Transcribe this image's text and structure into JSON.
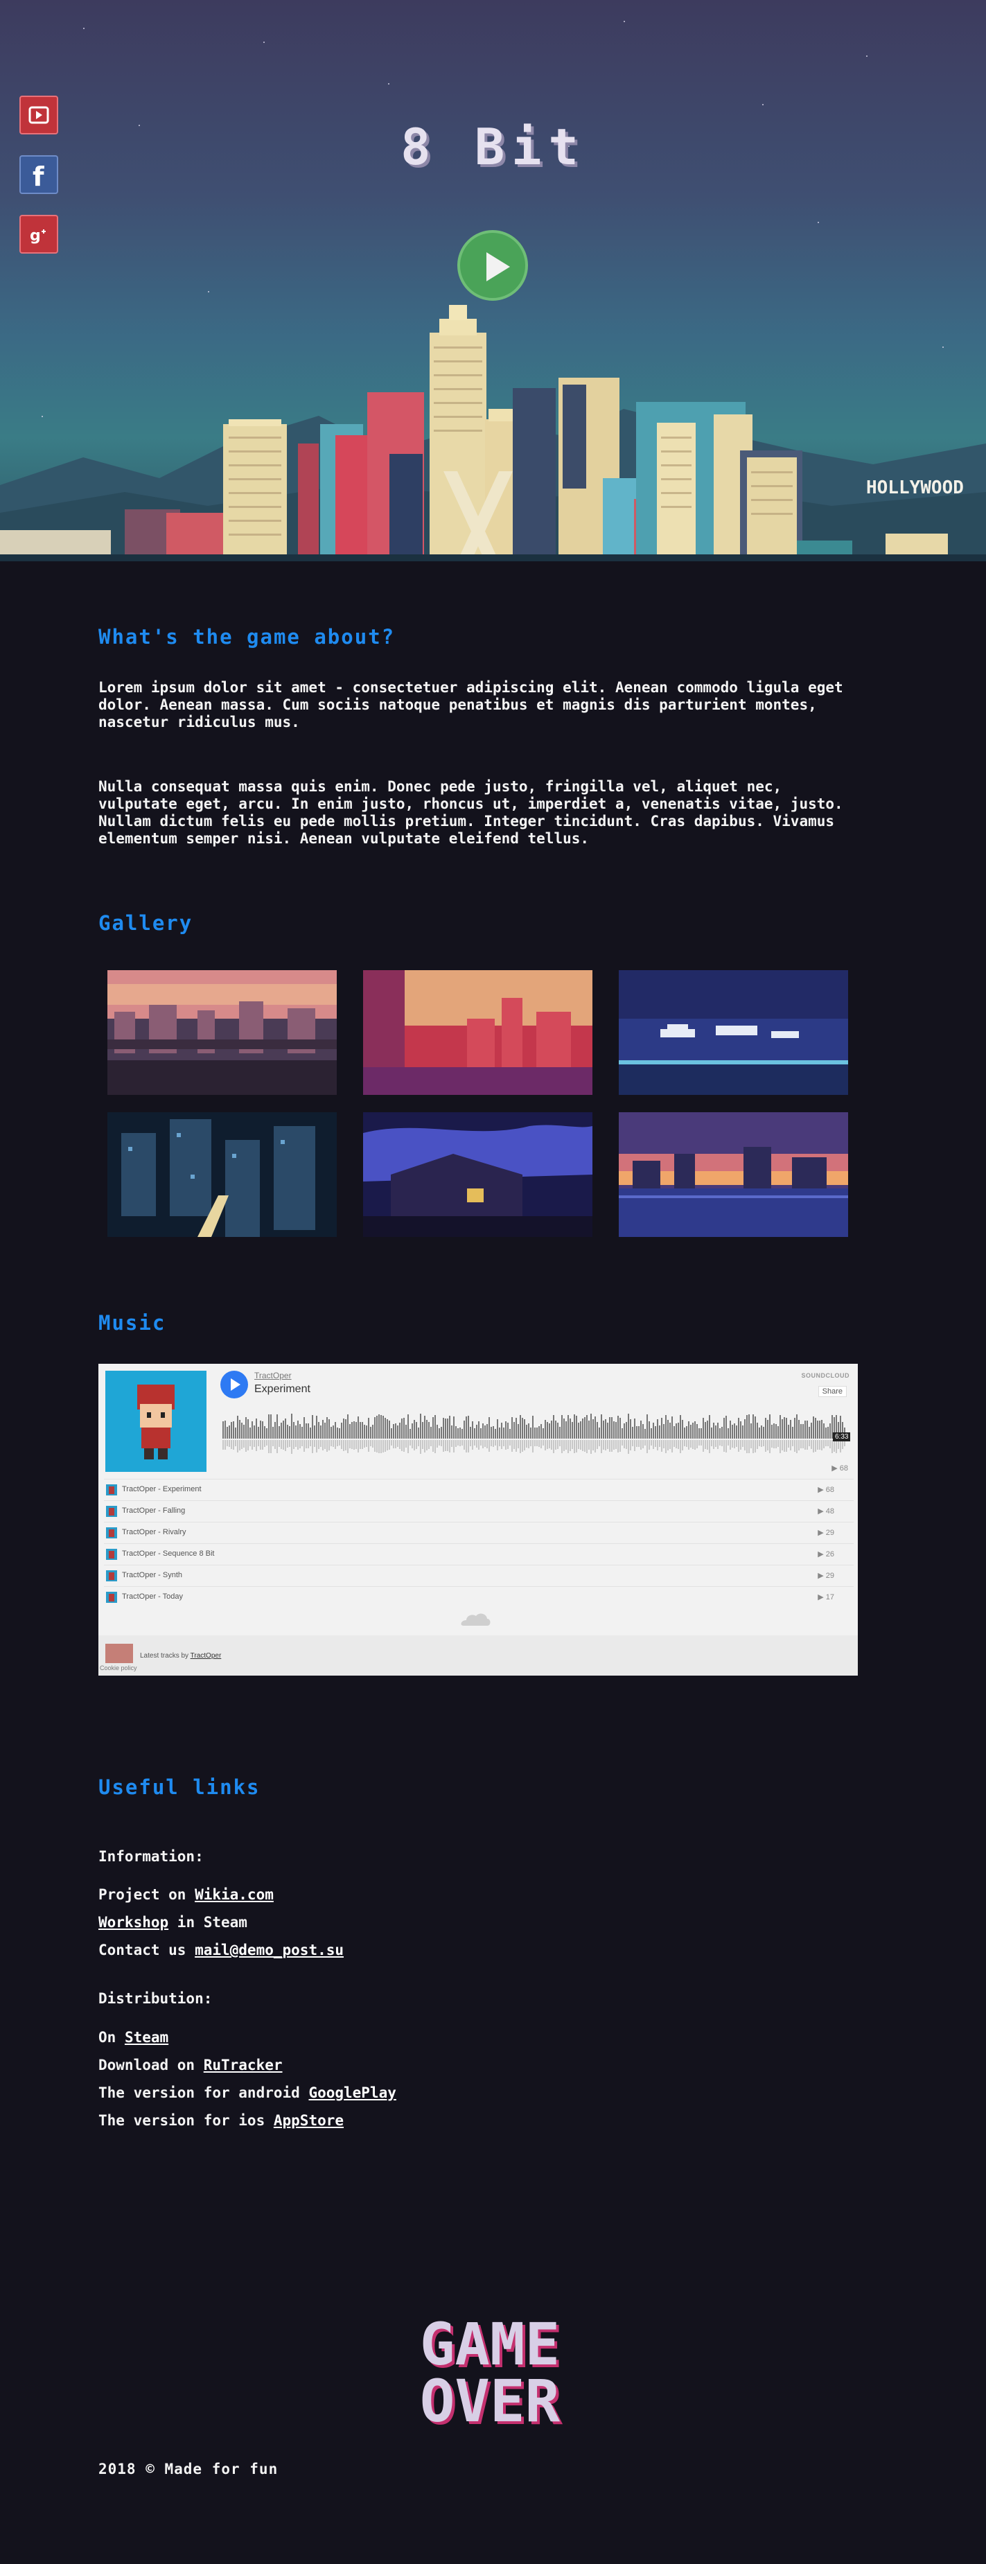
{
  "hero": {
    "title": "8 Bit",
    "sign": "HOLLYWOOD",
    "play_label": "play-icon"
  },
  "social": [
    {
      "name": "youtube-icon",
      "color": "#c0333a"
    },
    {
      "name": "facebook-icon",
      "color": "#3b5b99"
    },
    {
      "name": "google-plus-icon",
      "color": "#c0333a"
    }
  ],
  "about": {
    "heading": "What's the game about?",
    "p1": "Lorem ipsum dolor sit amet - consectetuer adipiscing elit. Aenean commodo ligula eget dolor. Aenean massa. Cum sociis natoque penatibus et magnis dis parturient montes, nascetur ridiculus mus.",
    "p2": "Nulla consequat massa quis enim. Donec pede justo, fringilla vel, aliquet nec, vulputate eget, arcu. In enim justo, rhoncus ut, imperdiet a, venenatis vitae, justo. Nullam dictum felis eu pede mollis pretium. Integer tincidunt. Cras dapibus. Vivamus elementum semper nisi. Aenean vulputate eleifend tellus."
  },
  "gallery": {
    "heading": "Gallery"
  },
  "music": {
    "heading": "Music",
    "user": "TractOper",
    "track": "Experiment",
    "brand": "SOUNDCLOUD",
    "share": "Share",
    "duration": "6:33",
    "plays": "▶ 68",
    "tracks": [
      {
        "name": "TractOper - Experiment",
        "plays": "▶ 68"
      },
      {
        "name": "TractOper - Falling",
        "plays": "▶ 48"
      },
      {
        "name": "TractOper - Rivalry",
        "plays": "▶ 29"
      },
      {
        "name": "TractOper - Sequence 8 Bit",
        "plays": "▶ 26"
      },
      {
        "name": "TractOper - Synth",
        "plays": "▶ 29"
      },
      {
        "name": "TractOper - Today",
        "plays": "▶ 17"
      }
    ],
    "latest_prefix": "Latest tracks by",
    "latest_user": "TractOper",
    "cookie": "Cookie policy"
  },
  "links": {
    "heading": "Useful links",
    "info_label": "Information:",
    "info": [
      {
        "pre": "Project on ",
        "link": "Wikia.com",
        "post": ""
      },
      {
        "pre": "",
        "link": "Workshop",
        "post": " in Steam"
      },
      {
        "pre": "Contact us ",
        "link": "mail@demo_post.su",
        "post": ""
      }
    ],
    "dist_label": "Distribution:",
    "dist": [
      {
        "pre": "On ",
        "link": "Steam",
        "post": ""
      },
      {
        "pre": "Download on ",
        "link": "RuTracker",
        "post": ""
      },
      {
        "pre": "The version for android ",
        "link": "GooglePlay",
        "post": ""
      },
      {
        "pre": "The version for ios ",
        "link": "AppStore",
        "post": ""
      }
    ]
  },
  "gameover": {
    "line1": "GAME",
    "line2": "OVER"
  },
  "footer": "2018 © Made for fun"
}
